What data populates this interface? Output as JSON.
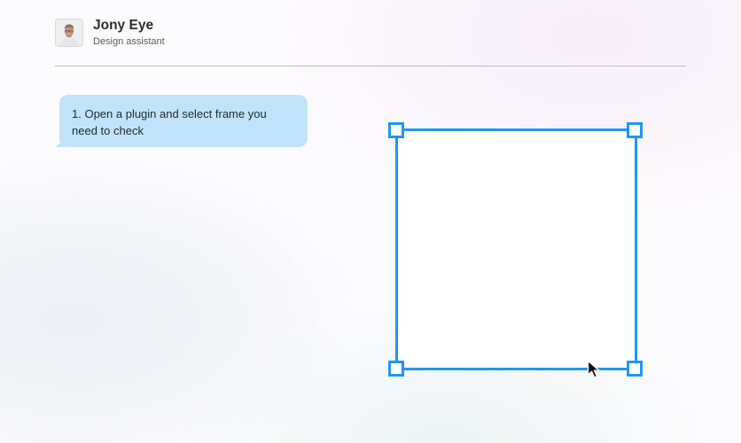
{
  "header": {
    "name": "Jony Eye",
    "role": "Design assistant",
    "avatar_icon": "person-portrait-icon"
  },
  "message": {
    "text": "1. Open a plugin and select frame you need to check"
  },
  "selection": {
    "accent_color": "#2196f0",
    "handle_icons": [
      "resize-handle-icon",
      "resize-handle-icon",
      "resize-handle-icon",
      "resize-handle-icon"
    ]
  },
  "cursor": {
    "icon": "arrow-pointer-icon"
  },
  "colors": {
    "bubble": "#c1e3fa",
    "divider": "#bdbdc3"
  }
}
